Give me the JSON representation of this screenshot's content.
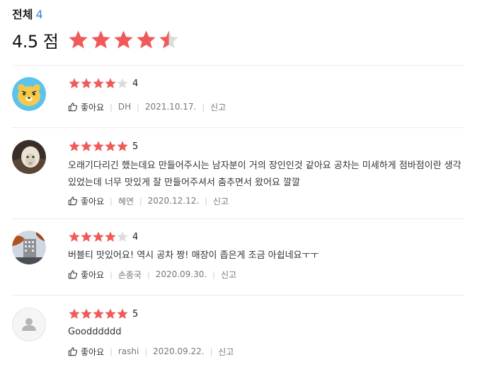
{
  "summary": {
    "total_label": "전체",
    "total_count": "4",
    "score": "4.5 점",
    "score_value": 4.5,
    "max_stars": 5
  },
  "colors": {
    "star_filled": "#f05a5a",
    "star_empty": "#dcdcdc",
    "count_accent": "#3b82d6"
  },
  "reviews": [
    {
      "rating": 4,
      "rating_label": "4",
      "text": "",
      "like_label": "좋아요",
      "author": "DH",
      "date": "2021.10.17.",
      "report_label": "신고",
      "avatar": "bear-face-icon"
    },
    {
      "rating": 5,
      "rating_label": "5",
      "text": "오래기다리긴 했는데요 만들어주시는 남자분이 거의 장인인것 같아요 공차는 미세하게 점바점이란 생각있었는데 너무 맛있게 잘 만들어주셔서 춤추면서 왔어요 깔깔",
      "like_label": "좋아요",
      "author": "혜연",
      "date": "2020.12.12.",
      "report_label": "신고",
      "avatar": "sheep-photo"
    },
    {
      "rating": 4,
      "rating_label": "4",
      "text": "버블티 맛있어요! 역시 공차 짱! 매장이 좁은게 조금 아쉽네요ㅜㅜ",
      "like_label": "좋아요",
      "author": "손종국",
      "date": "2020.09.30.",
      "report_label": "신고",
      "avatar": "building-photo"
    },
    {
      "rating": 5,
      "rating_label": "5",
      "text": "Goodddddd",
      "like_label": "좋아요",
      "author": "rashi",
      "date": "2020.09.22.",
      "report_label": "신고",
      "avatar": "default-user-icon"
    }
  ]
}
